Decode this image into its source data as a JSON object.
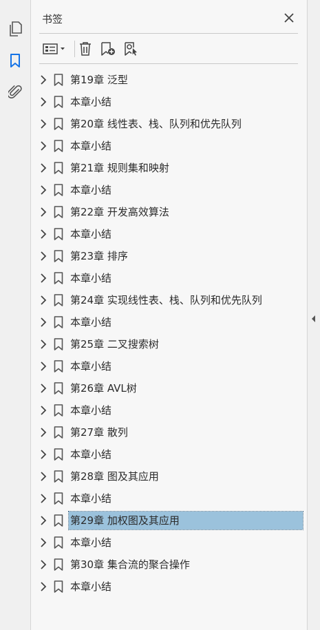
{
  "panel": {
    "title": "书签"
  },
  "rail": {
    "icons": [
      "pages-icon",
      "bookmark-icon",
      "attachment-icon"
    ],
    "active_color": "#1473e6"
  },
  "bookmarks": [
    {
      "label": "第19章  泛型"
    },
    {
      "label": "本章小结"
    },
    {
      "label": "第20章  线性表、栈、队列和优先队列"
    },
    {
      "label": "本章小结"
    },
    {
      "label": "第21章  规则集和映射"
    },
    {
      "label": "本章小结"
    },
    {
      "label": "第22章  开发高效算法"
    },
    {
      "label": "本章小结"
    },
    {
      "label": "第23章  排序"
    },
    {
      "label": "本章小结"
    },
    {
      "label": "第24章  实现线性表、栈、队列和优先队列"
    },
    {
      "label": "本章小结"
    },
    {
      "label": "第25章  二叉搜索树"
    },
    {
      "label": "本章小结"
    },
    {
      "label": "第26章  AVL树"
    },
    {
      "label": "本章小结"
    },
    {
      "label": "第27章  散列"
    },
    {
      "label": "本章小结"
    },
    {
      "label": "第28章  图及其应用"
    },
    {
      "label": "本章小结"
    },
    {
      "label": "第29章  加权图及其应用",
      "selected": true
    },
    {
      "label": "本章小结"
    },
    {
      "label": "第30章  集合流的聚合操作"
    },
    {
      "label": "本章小结"
    }
  ],
  "colors": {
    "selection": "#9bc2dc",
    "accent": "#1473e6"
  }
}
